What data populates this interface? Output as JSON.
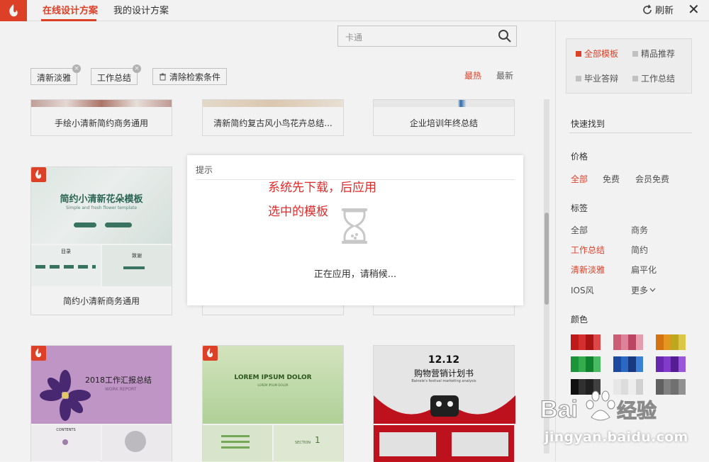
{
  "tabs": [
    {
      "label": "在线设计方案",
      "active": true
    },
    {
      "label": "我的设计方案",
      "active": false
    }
  ],
  "toolbar": {
    "refresh_label": "刷新",
    "close_label": "✕"
  },
  "search": {
    "value": "卡通"
  },
  "filters": {
    "chips": [
      "清新淡雅",
      "工作总结"
    ],
    "clear_label": "清除检索条件",
    "sort": [
      "最热",
      "最新"
    ]
  },
  "cards": [
    {
      "title": "手绘小清新简约商务通用"
    },
    {
      "title": "清新简约复古风小鸟花卉总结..."
    },
    {
      "title": "企业培训年终总结"
    },
    {
      "title": "简约小清新商务通用",
      "thumb_heading": "简约小清新花朵模板",
      "thumb_sub": "Simple and fresh flower template",
      "thumb_toc": "目录",
      "thumb_next": "致谢"
    },
    {
      "thumb_heading": "2018工作汇报总结",
      "thumb_sub": "WORK REPORT",
      "thumb_toc": "CONTENTS"
    },
    {
      "thumb_heading": "LOREM IPSUM DOLOR",
      "thumb_sub": "LOREM IPSUM DOLOR",
      "thumb_section": "SECTION",
      "thumb_num": "1"
    },
    {
      "thumb_heading": "12.12",
      "thumb_sub": "购物营销计划书",
      "thumb_caption": "Bainele's festival marketing analysis"
    }
  ],
  "right_panel": {
    "categories": [
      "全部模板",
      "精品推荐",
      "毕业答辩",
      "工作总结"
    ],
    "quick_find": "快速找到",
    "price_heading": "价格",
    "price_options": [
      "全部",
      "免费",
      "会员免费"
    ],
    "tag_heading": "标签",
    "tags": [
      "全部",
      "商务",
      "工作总结",
      "简约",
      "清新淡雅",
      "扁平化",
      "IOS风",
      "更多"
    ],
    "color_heading": "颜色"
  },
  "dialog": {
    "title": "提示",
    "status": "正在应用，请稍候..."
  },
  "annotation": {
    "line1": "系统先下载，后应用",
    "line2": "选中的模板"
  },
  "watermark": {
    "brand": "Bai 经验",
    "url": "jingyan.baidu.com"
  },
  "colors": {
    "accent": "#e8452b"
  }
}
